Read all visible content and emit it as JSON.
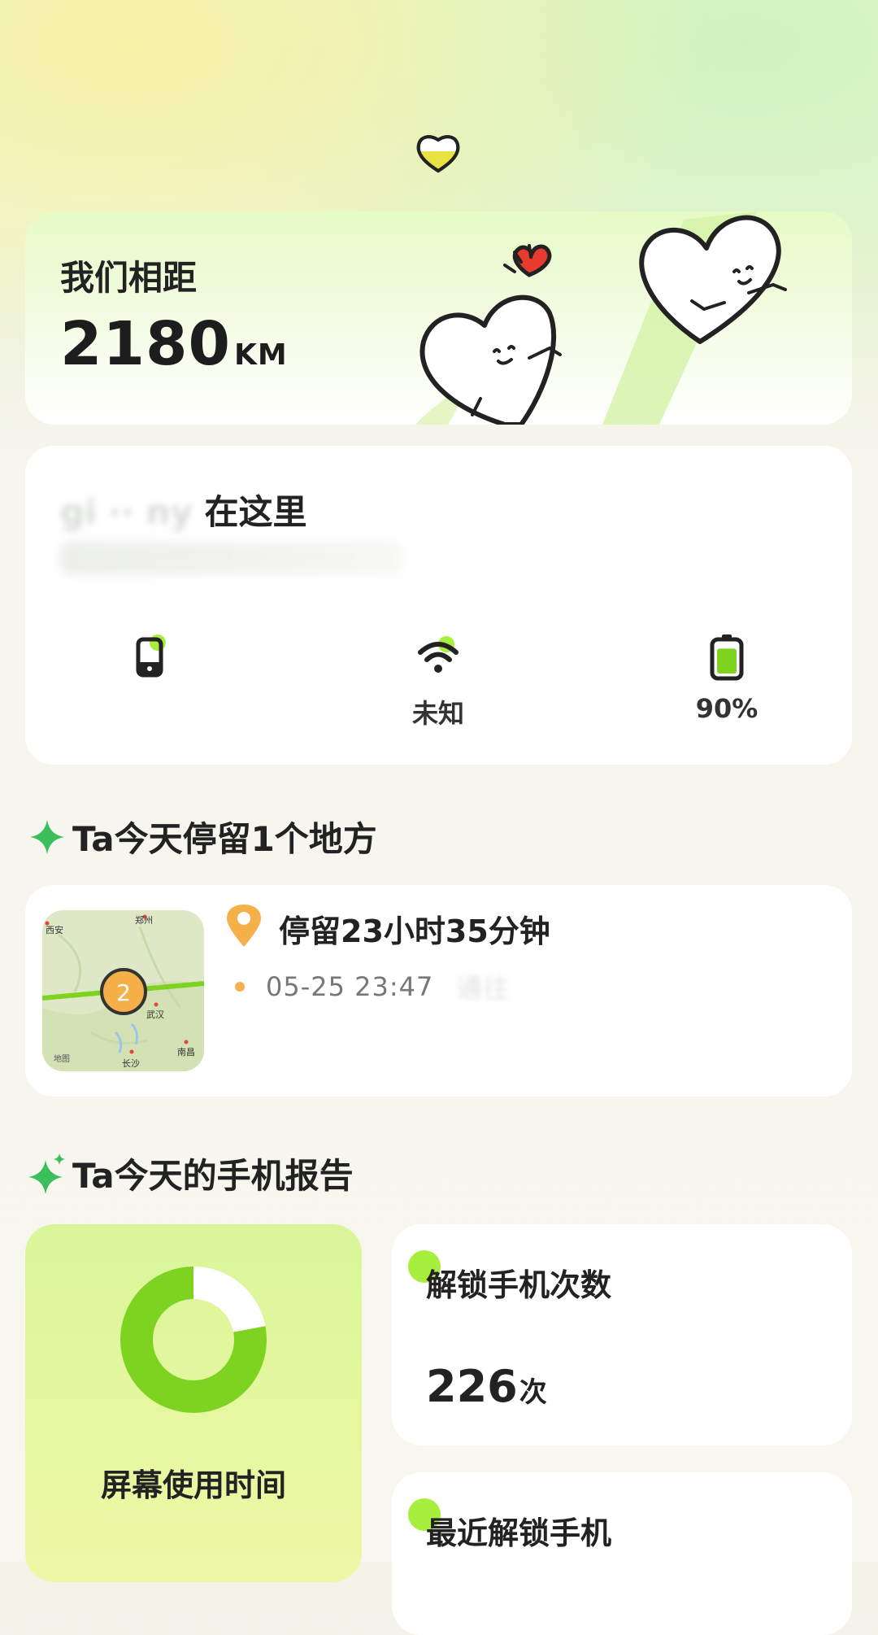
{
  "colors": {
    "accent": "#7ed321",
    "light_green": "#d9f59a",
    "orange": "#f5b04a"
  },
  "distance": {
    "label": "我们相距",
    "value": "2180",
    "unit": "KM"
  },
  "location": {
    "title_suffix": "在这里"
  },
  "status": {
    "phone": {
      "icon": "phone-icon",
      "value": ""
    },
    "wifi": {
      "icon": "wifi-icon",
      "value": "未知"
    },
    "battery": {
      "icon": "battery-icon",
      "value": "90%",
      "level": 0.9
    }
  },
  "places": {
    "section_title": "Ta今天停留1个地方",
    "stay": {
      "duration": "停留23小时35分钟",
      "time": "05-25 23:47",
      "map": {
        "cluster_count": "2",
        "cities": [
          "郑州",
          "西安",
          "武汉",
          "南昌",
          "长沙"
        ],
        "attribution": "地图"
      }
    }
  },
  "report": {
    "section_title": "Ta今天的手机报告",
    "screen_time": {
      "label": "屏幕使用时间",
      "ratio": 0.78
    },
    "unlock_count": {
      "label": "解锁手机次数",
      "value": "226",
      "unit": "次"
    },
    "recent_unlock": {
      "label": "最近解锁手机"
    }
  }
}
